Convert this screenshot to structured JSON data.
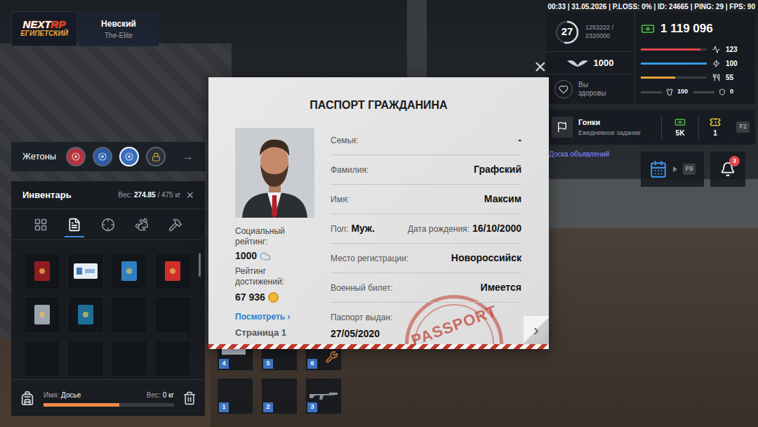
{
  "status_line": "00:33 | 31.05.2026 | P.LOSS: 0% | ID: 24665 | PING: 29 | FPS: 90",
  "logo": {
    "brand": "NEXT",
    "brand_accent": "RP",
    "server": "ЕГИПЕТСКИЙ"
  },
  "player": {
    "name": "Невский",
    "organization": "The-Elite"
  },
  "level": {
    "value": "27",
    "xp": "1253222 / 2320000",
    "level": 0.54
  },
  "social_points": "1000",
  "health_status": "Вы здоровы",
  "money": "1 119 096",
  "vitals": [
    {
      "value": "123",
      "level": 0.9,
      "color": "#e0474c"
    },
    {
      "value": "100",
      "level": 1,
      "color": "#2f9be3"
    },
    {
      "value": "55",
      "level": 0.52,
      "color": "#e9a43a"
    }
  ],
  "extras": [
    {
      "value": "100"
    },
    {
      "value": "0"
    }
  ],
  "daily_task": {
    "title": "Гонки",
    "subtitle": "Ежедневное задание",
    "reward_money": "5K",
    "reward_tokens": "1",
    "key": "F2"
  },
  "board_link": "Доска объявлений",
  "calendar_key": "F9",
  "notifications_count": "3",
  "tokens": {
    "title": "Жетоны",
    "arrow": "→",
    "items": [
      {
        "color": "#b8323a",
        "selected": false,
        "locked": false
      },
      {
        "color": "#2d5ca6",
        "selected": false,
        "locked": false
      },
      {
        "color": "#3a6fc0",
        "selected": true,
        "locked": false
      },
      {
        "color": "#d1a43c",
        "selected": false,
        "locked": true
      }
    ]
  },
  "inventory": {
    "title": "Инвентарь",
    "weight_label": "Вес:",
    "weight": "274.85",
    "weight_max": "/ 475 кг",
    "close": "×",
    "tabs": [
      {
        "selected": false
      },
      {
        "selected": true
      },
      {
        "selected": false
      },
      {
        "selected": false
      },
      {
        "selected": false
      }
    ],
    "items": [
      {
        "kind": "book",
        "color": "#8f1c1f"
      },
      {
        "kind": "card",
        "color": "#e6edf5"
      },
      {
        "kind": "book",
        "color": "#2f7fc0"
      },
      {
        "kind": "book",
        "color": "#cf2f2b"
      },
      {
        "kind": "book",
        "color": "#9aa5ae"
      },
      {
        "kind": "book",
        "color": "#1d6f95"
      },
      {
        "kind": "empty",
        "color": "#14171c"
      },
      {
        "kind": "empty",
        "color": "#14171c"
      },
      {
        "kind": "empty",
        "color": "#14171c"
      },
      {
        "kind": "empty",
        "color": "#14171c"
      },
      {
        "kind": "empty",
        "color": "#14171c"
      },
      {
        "kind": "empty",
        "color": "#14171c"
      }
    ],
    "bag": {
      "name_label": "Имя:",
      "name": "Досье",
      "weight_label": "Вес:",
      "weight": "0 кг",
      "level": 0.58
    }
  },
  "passport": {
    "title": "ПАСПОРТ ГРАЖДАНИНА",
    "social_rating_label": "Социальный рейтинг:",
    "social_rating": "1000",
    "achievements_label": "Рейтинг достижений:",
    "achievements": "67 936",
    "view_link": "Посмотреть ›",
    "page": "Страница 1",
    "stamp": "PASSPORT",
    "next": "›",
    "close": "×",
    "rows": [
      {
        "kind": "line",
        "fields": [
          {
            "label": "Семья:",
            "value": "-"
          }
        ]
      },
      {
        "kind": "line",
        "fields": [
          {
            "label": "Фамилия:",
            "value": "Графский"
          }
        ]
      },
      {
        "kind": "line",
        "fields": [
          {
            "label": "Имя:",
            "value": "Максим"
          }
        ]
      },
      {
        "kind": "pair",
        "fields": [
          {
            "label": "Пол:",
            "value": "Муж."
          },
          {
            "label": "Дата рождения:",
            "value": "16/10/2000"
          }
        ]
      },
      {
        "kind": "line",
        "fields": [
          {
            "label": "Место регистрации:",
            "value": "Новороссийск"
          }
        ]
      },
      {
        "kind": "line",
        "fields": [
          {
            "label": "Военный билет:",
            "value": "Имеется"
          }
        ]
      },
      {
        "kind": "stacked",
        "fields": [
          {
            "label": "Паспорт выдан:",
            "value": "27/05/2020"
          }
        ]
      }
    ]
  },
  "hotbar": [
    {
      "key": "4",
      "kind": "item"
    },
    {
      "key": "5",
      "kind": "empty"
    },
    {
      "key": "6",
      "kind": "tool"
    },
    {
      "key": "1",
      "kind": "empty"
    },
    {
      "key": "2",
      "kind": "empty"
    },
    {
      "key": "3",
      "kind": "rifle"
    }
  ]
}
